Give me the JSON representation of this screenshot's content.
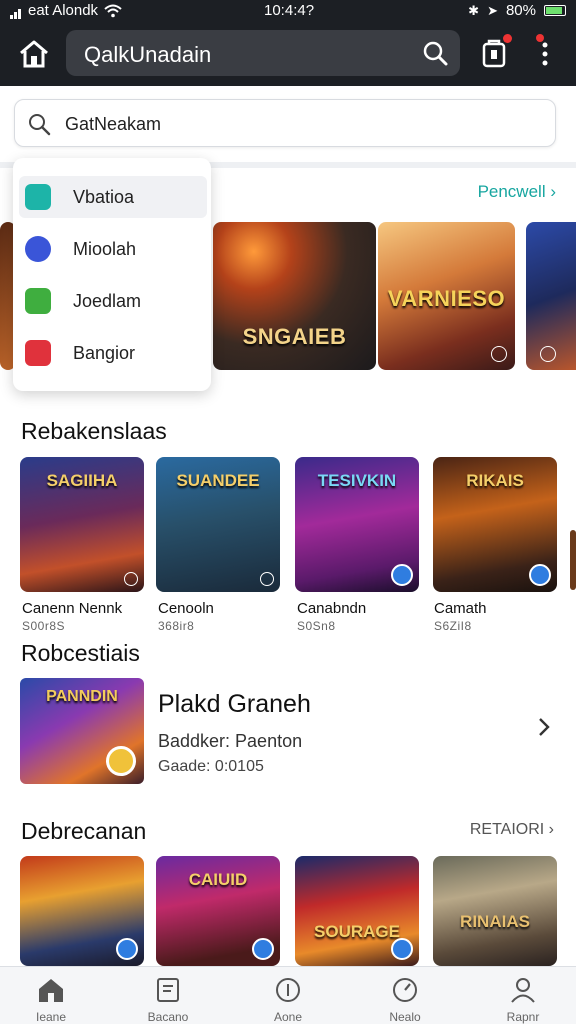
{
  "status": {
    "carrier": "eat Alondk",
    "time": "10:4:4?",
    "battery": "80%"
  },
  "app": {
    "title": "QalkUnadain"
  },
  "search": {
    "text": "GatNeakam"
  },
  "dropdown": {
    "items": [
      {
        "label": "Vbatioa",
        "color": "#1db4a8"
      },
      {
        "label": "Mioolah",
        "color": "#3a55d8"
      },
      {
        "label": "Joedlam",
        "color": "#3fae3f"
      },
      {
        "label": "Bangior",
        "color": "#e0323c"
      }
    ]
  },
  "featured": {
    "link": "Pencwell",
    "cards": [
      {
        "label": "SNGAIEB"
      },
      {
        "label": "VARNIESO"
      },
      {
        "label": ""
      }
    ]
  },
  "section1": {
    "title": "Rebakenslaas",
    "tiles": [
      {
        "art": "SAGIIHA",
        "name": "Canenn Nennk",
        "sub": "S00r8S"
      },
      {
        "art": "SUANDEE",
        "name": "Cenooln",
        "sub": "368ir8"
      },
      {
        "art": "TESIVKIN",
        "name": "Canabndn",
        "sub": "S0Sn8"
      },
      {
        "art": "RIKAIS",
        "name": "Camath",
        "sub": "S6ZiI8"
      }
    ]
  },
  "section2": {
    "title": "Robcestiais",
    "item": {
      "art": "PANNDIN",
      "title": "Plakd Graneh",
      "line1": "Baddker: Paenton",
      "line2": "Gaade: 0:0105"
    }
  },
  "section3": {
    "title": "Debrecanan",
    "see_all": "RETAIORI",
    "tiles": [
      {
        "art": ""
      },
      {
        "art": "CAIUID"
      },
      {
        "art": "SOURAGE"
      },
      {
        "art": "RINAIAS"
      }
    ]
  },
  "nav": [
    {
      "label": "Ieane",
      "icon": "home-icon"
    },
    {
      "label": "Bacano",
      "icon": "document-icon"
    },
    {
      "label": "Aone",
      "icon": "plus-circle-icon"
    },
    {
      "label": "Nealo",
      "icon": "gauge-icon"
    },
    {
      "label": "Rapnr",
      "icon": "person-icon"
    }
  ]
}
